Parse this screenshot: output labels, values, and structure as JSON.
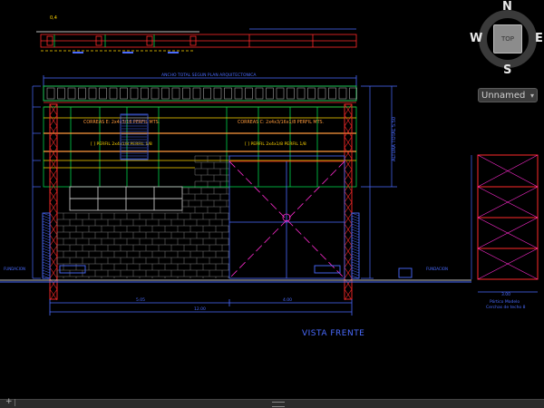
{
  "viewcube": {
    "north": "N",
    "south": "S",
    "east": "E",
    "west": "W",
    "face": "TOP"
  },
  "ucs": {
    "label": "Unnamed",
    "caret": "▾"
  },
  "drawing": {
    "title": "VISTA FRENTE",
    "level_label": "0,4",
    "side_label": "Pórtico Modelo",
    "side_sublabel": "Cerchas de techo 8",
    "top_dim": "ANCHO TOTAL SEGUN PLAN ARQUITECTONICA",
    "beam_left": "CORREAS E: 2x4x3/16 PERFIL MTS.",
    "beam_right": "CORREAS C: 2x4x3/16x1/8 PERFIL MTS.",
    "rail_left": "[ ] PERFIL 2x4x1/8 PERFIL 1/8",
    "rail_right": "[ ] PERFIL 2x4x1/8 PERFIL 1/8",
    "right_height": "ALTURA TOTAL 5.50",
    "bottom_dim": "12.00",
    "dim_left": "5.05",
    "dim_right": "4.00",
    "side_dim": "3.00",
    "base_left": "FUNDACION",
    "base_right": "FUNDACION"
  },
  "statusbar": {
    "plus": "+",
    "sep": "|"
  }
}
